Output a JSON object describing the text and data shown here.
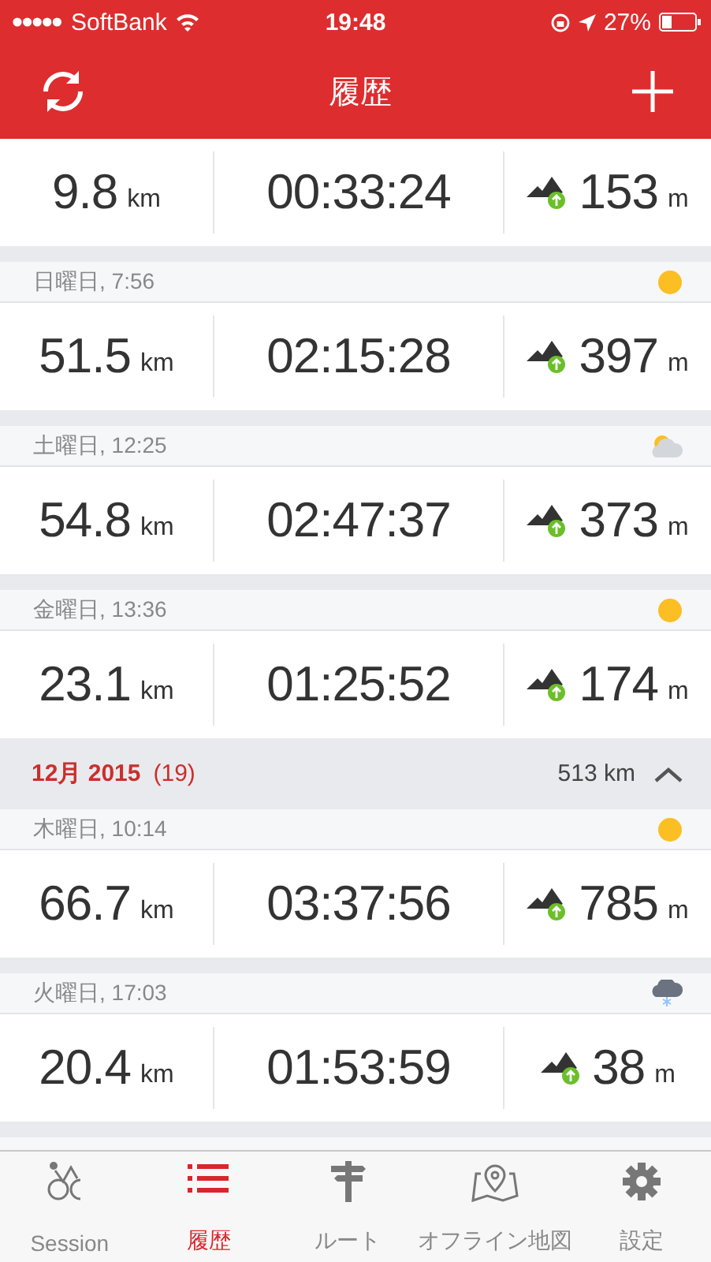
{
  "status_bar": {
    "carrier": "SoftBank",
    "time": "19:48",
    "battery_text": "27%"
  },
  "nav": {
    "title": "履歴"
  },
  "list": [
    {
      "kind": "stats",
      "distance": "9.8",
      "distance_unit": "km",
      "duration": "00:33:24",
      "ascent": "153",
      "ascent_unit": "m"
    },
    {
      "kind": "day",
      "label": "日曜日, 7:56",
      "weather": {
        "kind": "sun"
      }
    },
    {
      "kind": "stats",
      "distance": "51.5",
      "distance_unit": "km",
      "duration": "02:15:28",
      "ascent": "397",
      "ascent_unit": "m"
    },
    {
      "kind": "day",
      "label": "土曜日, 12:25",
      "weather": {
        "kind": "partly_cloudy"
      }
    },
    {
      "kind": "stats",
      "distance": "54.8",
      "distance_unit": "km",
      "duration": "02:47:37",
      "ascent": "373",
      "ascent_unit": "m"
    },
    {
      "kind": "day",
      "label": "金曜日, 13:36",
      "weather": {
        "kind": "sun"
      }
    },
    {
      "kind": "stats",
      "distance": "23.1",
      "distance_unit": "km",
      "duration": "01:25:52",
      "ascent": "174",
      "ascent_unit": "m"
    },
    {
      "kind": "month",
      "month": "12月 2015",
      "count": "(19)",
      "total": "513 km",
      "expanded": true
    },
    {
      "kind": "day",
      "label": "木曜日, 10:14",
      "weather": {
        "kind": "sun"
      }
    },
    {
      "kind": "stats",
      "distance": "66.7",
      "distance_unit": "km",
      "duration": "03:37:56",
      "ascent": "785",
      "ascent_unit": "m"
    },
    {
      "kind": "day",
      "label": "火曜日, 17:03",
      "weather": {
        "kind": "snow_cloud"
      }
    },
    {
      "kind": "stats",
      "distance": "20.4",
      "distance_unit": "km",
      "duration": "01:53:59",
      "ascent": "38",
      "ascent_unit": "m"
    },
    {
      "kind": "day_cut"
    }
  ],
  "tabs": [
    {
      "label": "Session",
      "selected": false
    },
    {
      "label": "履歴",
      "selected": true
    },
    {
      "label": "ルート",
      "selected": false
    },
    {
      "label": "オフライン地図",
      "selected": false
    },
    {
      "label": "設定",
      "selected": false
    }
  ]
}
